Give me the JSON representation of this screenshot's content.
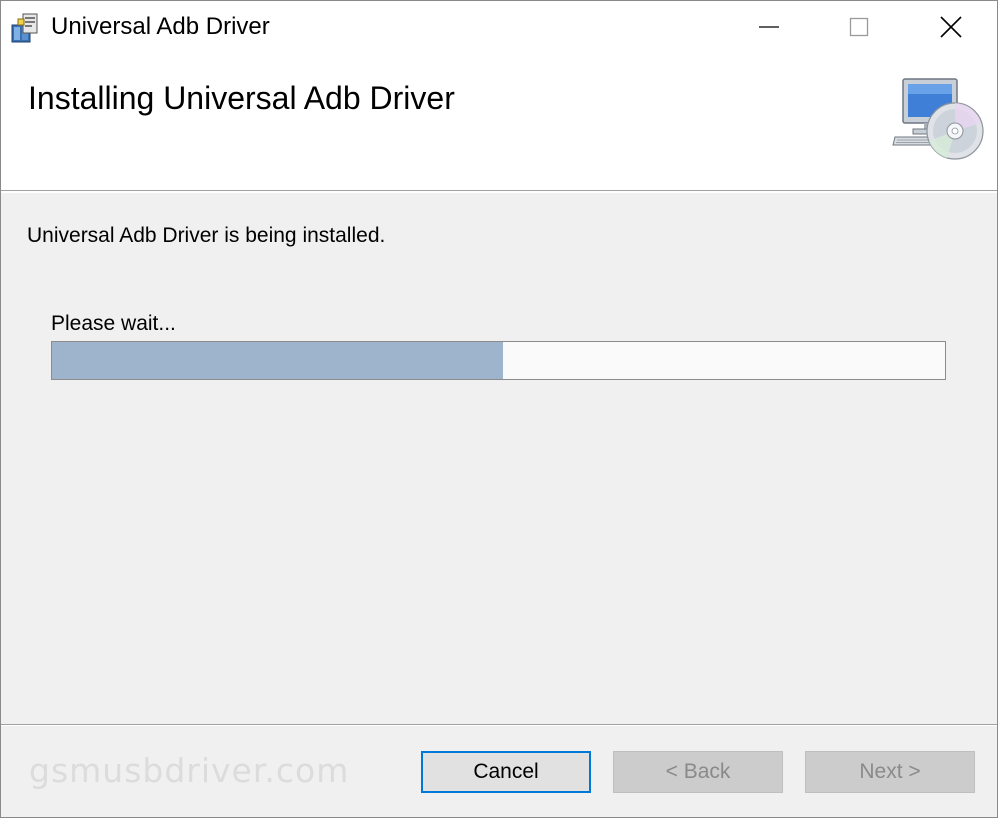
{
  "window": {
    "title": "Universal Adb Driver",
    "app_icon": "installer-box-icon"
  },
  "caption_buttons": {
    "minimize_icon": "minimize-icon",
    "maximize_icon": "maximize-icon",
    "close_icon": "close-icon"
  },
  "banner": {
    "title": "Installing Universal Adb Driver",
    "icon": "computer-cd-icon"
  },
  "body": {
    "status": "Universal Adb Driver is being installed.",
    "wait_label": "Please wait...",
    "progress_fraction": 0.505
  },
  "footer": {
    "watermark": "gsmusbdriver.com",
    "cancel_label": "Cancel",
    "back_label": "< Back",
    "next_label": "Next >"
  },
  "colors": {
    "progress_fill": "#9eb3cc",
    "focus_border": "#0078d7",
    "window_bg": "#f0f0f0"
  }
}
